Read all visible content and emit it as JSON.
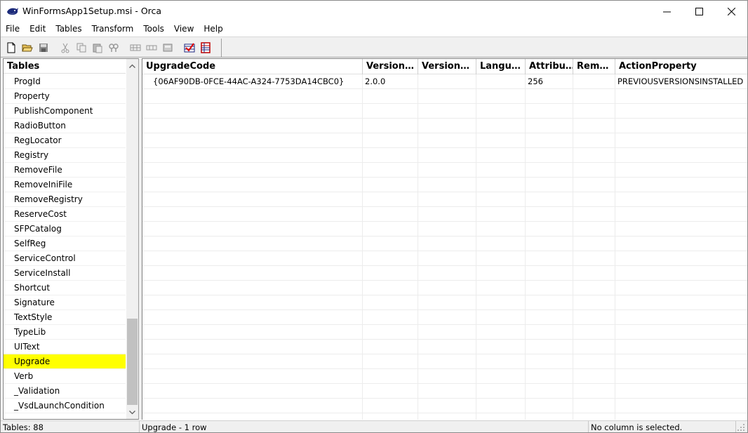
{
  "window": {
    "title": "WinFormsApp1Setup.msi - Orca"
  },
  "menu": {
    "items": [
      "File",
      "Edit",
      "Tables",
      "Transform",
      "Tools",
      "View",
      "Help"
    ]
  },
  "toolbar": {
    "icons": [
      "new-icon",
      "open-icon",
      "save-icon",
      "cut-icon",
      "copy-icon",
      "paste-icon",
      "find-icon",
      "add-row-icon",
      "drop-table-icon",
      "export-icon",
      "validate-icon",
      "table-icon"
    ]
  },
  "tables_pane": {
    "header": "Tables",
    "items": [
      "ProgId",
      "Property",
      "PublishComponent",
      "RadioButton",
      "RegLocator",
      "Registry",
      "RemoveFile",
      "RemoveIniFile",
      "RemoveRegistry",
      "ReserveCost",
      "SFPCatalog",
      "SelfReg",
      "ServiceControl",
      "ServiceInstall",
      "Shortcut",
      "Signature",
      "TextStyle",
      "TypeLib",
      "UIText",
      "Upgrade",
      "Verb",
      "_Validation",
      "_VsdLaunchCondition"
    ],
    "selected": "Upgrade",
    "selected_color": "#ffff00"
  },
  "grid": {
    "columns": [
      "UpgradeCode",
      "Version…",
      "Version…",
      "Langu…",
      "Attribu…",
      "Rem…",
      "ActionProperty"
    ],
    "rows": [
      [
        "{06AF90DB-0FCE-44AC-A324-7753DA14CBC0}",
        "2.0.0",
        "",
        "",
        "256",
        "",
        "PREVIOUSVERSIONSINSTALLED"
      ]
    ]
  },
  "status": {
    "tables_count": "Tables: 88",
    "table_info": "Upgrade - 1 row",
    "column_info": "No column is selected."
  }
}
